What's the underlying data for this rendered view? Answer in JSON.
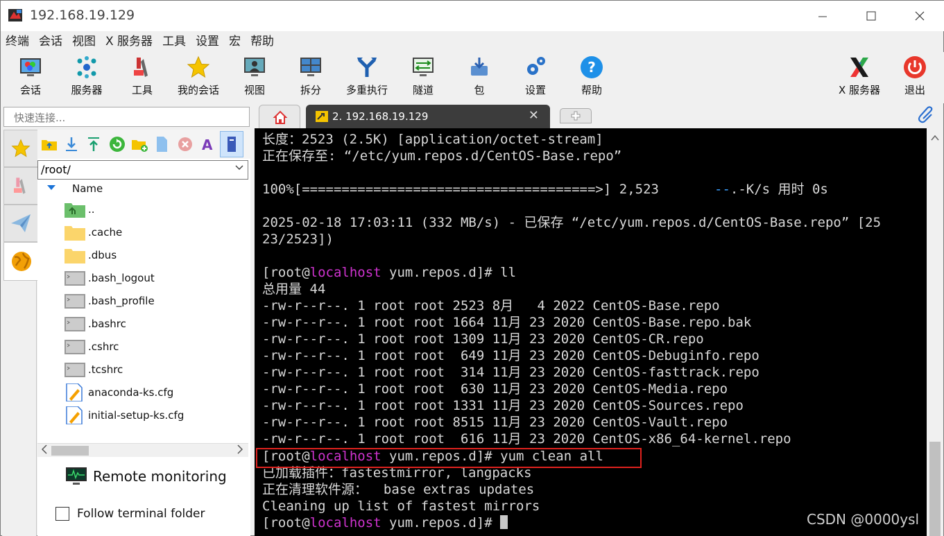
{
  "window": {
    "title": "192.168.19.129"
  },
  "menu": [
    "终端",
    "会话",
    "视图",
    "X 服务器",
    "工具",
    "设置",
    "宏",
    "帮助"
  ],
  "toolbar": {
    "session": "会话",
    "servers": "服务器",
    "tools": "工具",
    "my_sessions": "我的会话",
    "view": "视图",
    "split": "拆分",
    "multiexec": "多重执行",
    "tunnel": "隧道",
    "packages": "包",
    "settings": "设置",
    "help": "帮助",
    "xserver": "X 服务器",
    "exit": "退出"
  },
  "quick_connect": {
    "placeholder": "快速连接..."
  },
  "tabs": {
    "active_label": "2. 192.168.19.129",
    "close_glyph": "✕"
  },
  "file_panel": {
    "path": "/root/",
    "column_header": "Name",
    "items": [
      {
        "name": "..",
        "type": "parent"
      },
      {
        "name": ".cache",
        "type": "folder"
      },
      {
        "name": ".dbus",
        "type": "folder"
      },
      {
        "name": ".bash_logout",
        "type": "file"
      },
      {
        "name": ".bash_profile",
        "type": "file"
      },
      {
        "name": ".bashrc",
        "type": "file"
      },
      {
        "name": ".cshrc",
        "type": "file"
      },
      {
        "name": ".tcshrc",
        "type": "file"
      },
      {
        "name": "anaconda-ks.cfg",
        "type": "cfg"
      },
      {
        "name": "initial-setup-ks.cfg",
        "type": "cfg"
      }
    ],
    "remote_monitoring": "Remote monitoring",
    "follow_terminal": "Follow terminal folder",
    "follow_checked": false
  },
  "terminal": {
    "prompt_user": "localhost",
    "lines": {
      "l1": "长度：2523 (2.5K) [application/octet-stream]",
      "l2": "正在保存至: “/etc/yum.repos.d/CentOS-Base.repo”",
      "l3a": "100%[=====================================>] 2,523       ",
      "l3b": "--",
      "l3c": ".-K/s 用时 0s",
      "l4": "2025-02-18 17:03:11 (332 MB/s) - 已保存 “/etc/yum.repos.d/CentOS-Base.repo” [25",
      "l5": "23/2523])",
      "p1_pre": "[root@",
      "p1_post": " yum.repos.d]# ll",
      "l6": "总用量 44",
      "ls": [
        "-rw-r--r--. 1 root root 2523 8月   4 2022 CentOS-Base.repo",
        "-rw-r--r--. 1 root root 1664 11月 23 2020 CentOS-Base.repo.bak",
        "-rw-r--r--. 1 root root 1309 11月 23 2020 CentOS-CR.repo",
        "-rw-r--r--. 1 root root  649 11月 23 2020 CentOS-Debuginfo.repo",
        "-rw-r--r--. 1 root root  314 11月 23 2020 CentOS-fasttrack.repo",
        "-rw-r--r--. 1 root root  630 11月 23 2020 CentOS-Media.repo",
        "-rw-r--r--. 1 root root 1331 11月 23 2020 CentOS-Sources.repo",
        "-rw-r--r--. 1 root root 8515 11月 23 2020 CentOS-Vault.repo",
        "-rw-r--r--. 1 root root  616 11月 23 2020 CentOS-x86_64-kernel.repo"
      ],
      "p2_pre": "[root@",
      "p2_post": " yum.repos.d]# yum clean all",
      "l7": "已加载插件：fastestmirror, langpacks",
      "l8": "正在清理软件源：  base extras updates",
      "l9": "Cleaning up list of fastest mirrors",
      "p3_pre": "[root@",
      "p3_post": " yum.repos.d]# "
    }
  },
  "watermark": "CSDN @0000ysl",
  "colors": {
    "terminal_bg": "#000000",
    "prompt_host": "#cf33cf",
    "highlight_box": "#e0221e"
  }
}
